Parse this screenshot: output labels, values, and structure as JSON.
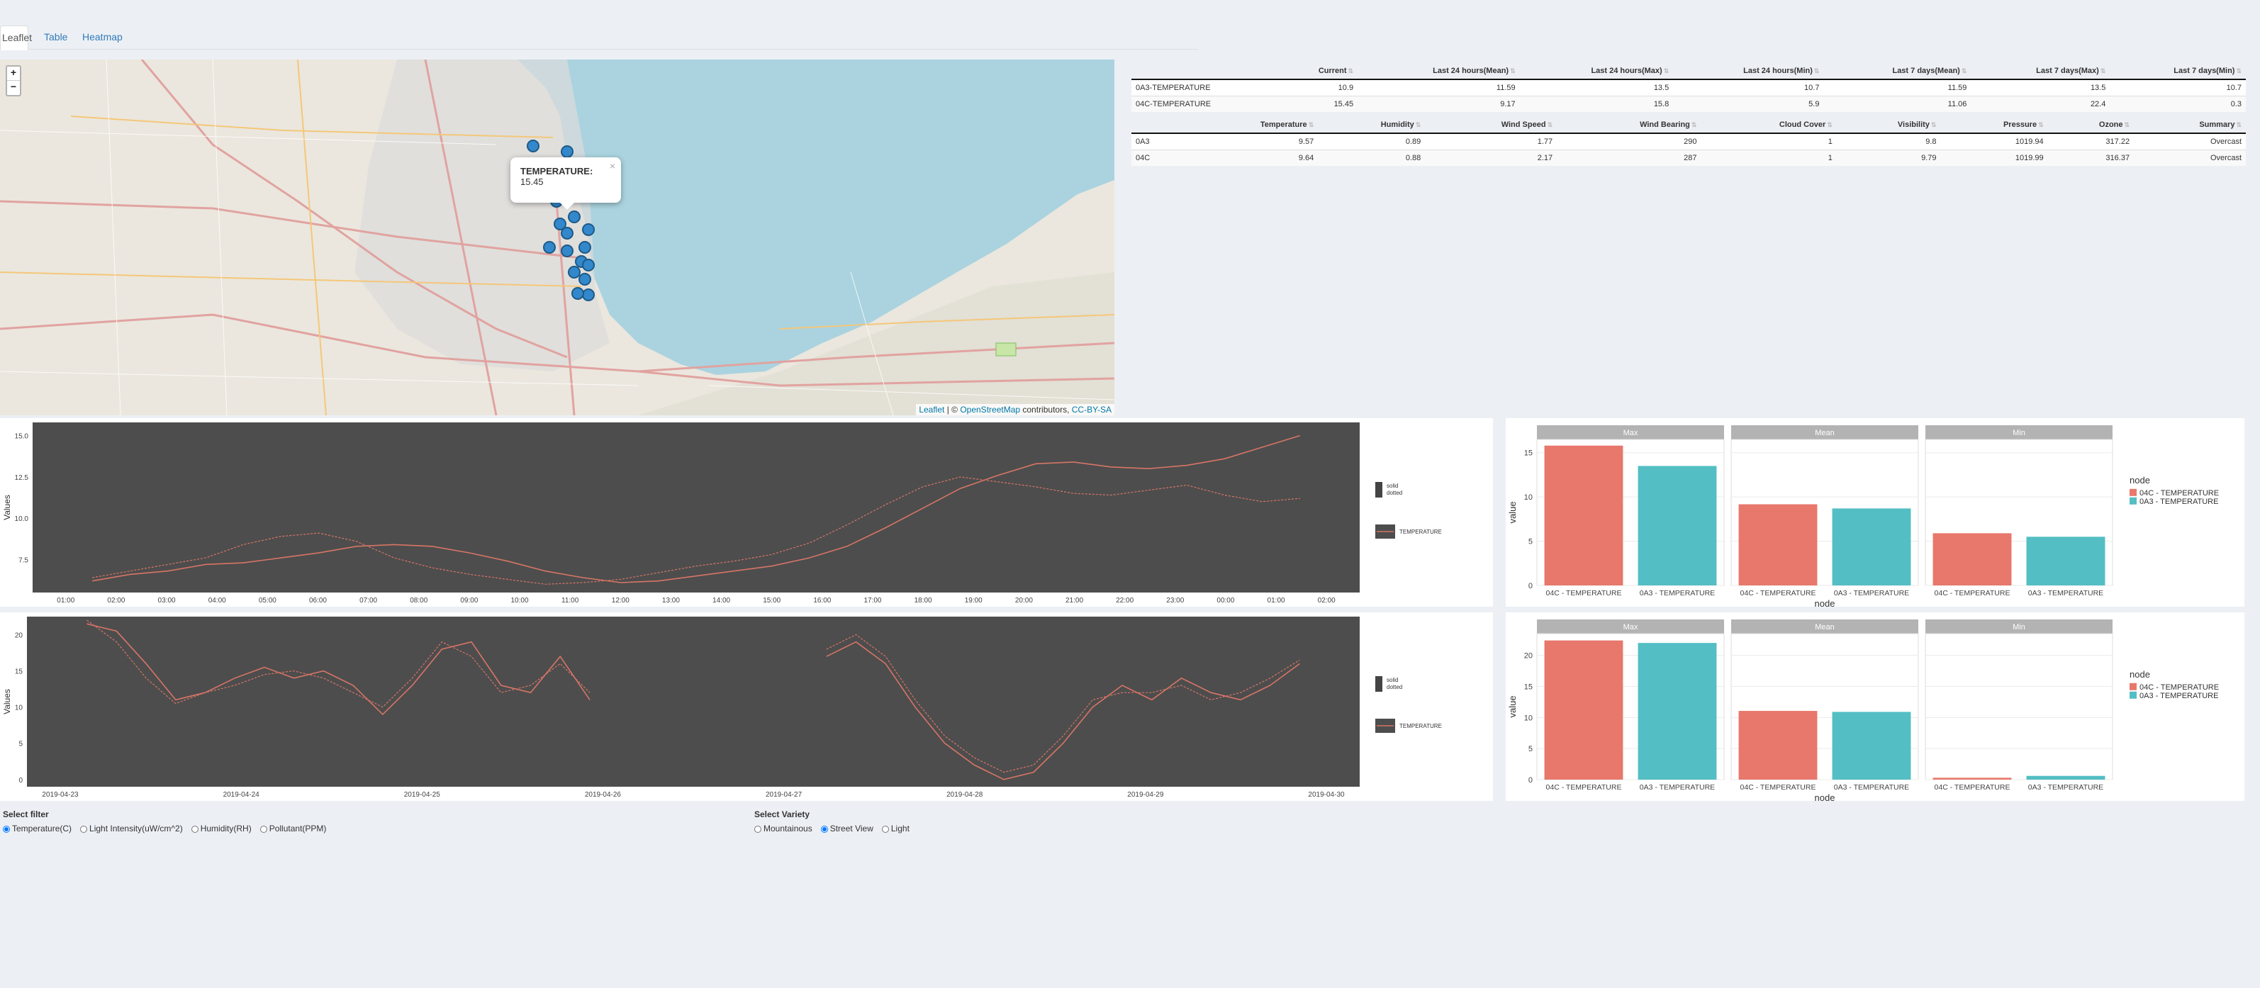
{
  "tabs": [
    {
      "label": "Leaflet"
    },
    {
      "label": "Table"
    },
    {
      "label": "Heatmap"
    }
  ],
  "map": {
    "zoom_in": "+",
    "zoom_out": "−",
    "popup": {
      "label": "TEMPERATURE:",
      "value": "15.45"
    },
    "attribution": {
      "leaflet": "Leaflet",
      "sep": " | © ",
      "osm": "OpenStreetMap",
      "contrib": " contributors, ",
      "license": "CC-BY-SA"
    }
  },
  "summary_table": {
    "headers": [
      "",
      "Current",
      "Last 24 hours(Mean)",
      "Last 24 hours(Max)",
      "Last 24 hours(Min)",
      "Last 7 days(Mean)",
      "Last 7 days(Max)",
      "Last 7 days(Min)"
    ],
    "rows": [
      [
        "0A3-TEMPERATURE",
        "10.9",
        "11.59",
        "13.5",
        "10.7",
        "11.59",
        "13.5",
        "10.7"
      ],
      [
        "04C-TEMPERATURE",
        "15.45",
        "9.17",
        "15.8",
        "5.9",
        "11.06",
        "22.4",
        "0.3"
      ]
    ]
  },
  "weather_table": {
    "headers": [
      "",
      "Temperature",
      "Humidity",
      "Wind Speed",
      "Wind Bearing",
      "Cloud Cover",
      "Visibility",
      "Pressure",
      "Ozone",
      "Summary"
    ],
    "rows": [
      [
        "0A3",
        "9.57",
        "0.89",
        "1.77",
        "290",
        "1",
        "9.8",
        "1019.94",
        "317.22",
        "Overcast"
      ],
      [
        "04C",
        "9.64",
        "0.88",
        "2.17",
        "287",
        "1",
        "9.79",
        "1019.99",
        "316.37",
        "Overcast"
      ]
    ]
  },
  "chart_data": [
    {
      "type": "line",
      "ylabel": "Values",
      "x_ticks": [
        "01:00",
        "02:00",
        "03:00",
        "04:00",
        "05:00",
        "06:00",
        "07:00",
        "08:00",
        "09:00",
        "10:00",
        "11:00",
        "12:00",
        "13:00",
        "14:00",
        "15:00",
        "16:00",
        "17:00",
        "18:00",
        "19:00",
        "20:00",
        "21:00",
        "22:00",
        "23:00",
        "00:00",
        "01:00",
        "02:00"
      ],
      "y_ticks": [
        "15.0",
        "12.5",
        "10.0",
        "7.5"
      ],
      "ylim": [
        5.5,
        15.8
      ],
      "legend": {
        "lt1": "solid",
        "lt2": "dotted",
        "series": "TEMPERATURE"
      },
      "series": [
        {
          "values": [
            6.2,
            6.6,
            6.8,
            7.2,
            7.3,
            7.6,
            7.9,
            8.3,
            8.4,
            8.3,
            7.9,
            7.4,
            6.8,
            6.4,
            6.1,
            6.2,
            6.5,
            6.8,
            7.1,
            7.6,
            8.3,
            9.4,
            10.6,
            11.8,
            12.6,
            13.3,
            13.4,
            13.1,
            13.0,
            13.2,
            13.6,
            14.3,
            15.0
          ]
        },
        {
          "values": [
            6.4,
            6.8,
            7.2,
            7.6,
            8.4,
            8.9,
            9.1,
            8.6,
            7.6,
            7.0,
            6.6,
            6.3,
            6.0,
            6.1,
            6.3,
            6.7,
            7.1,
            7.4,
            7.8,
            8.5,
            9.6,
            10.8,
            11.9,
            12.5,
            12.2,
            11.9,
            11.5,
            11.4,
            11.7,
            12.0,
            11.4,
            11.0,
            11.2
          ]
        }
      ]
    },
    {
      "type": "line",
      "ylabel": "Values",
      "x_ticks": [
        "2019-04-23",
        "2019-04-24",
        "2019-04-25",
        "2019-04-26",
        "2019-04-27",
        "2019-04-28",
        "2019-04-29",
        "2019-04-30"
      ],
      "y_ticks": [
        "20",
        "15",
        "10",
        "5",
        "0"
      ],
      "ylim": [
        -1,
        22.5
      ],
      "legend": {
        "lt1": "solid",
        "lt2": "dotted",
        "series": "TEMPERATURE"
      },
      "series": [
        {
          "values": [
            21.5,
            20.5,
            16,
            11,
            12,
            14,
            15.5,
            14,
            15,
            13,
            9,
            13,
            18,
            19,
            13,
            12,
            17,
            11,
            null,
            null,
            null,
            null,
            null,
            null,
            null,
            17,
            19,
            16,
            10,
            5,
            2,
            0,
            1,
            5,
            10,
            13,
            11,
            14,
            12,
            11,
            13,
            16
          ]
        },
        {
          "values": [
            22,
            19,
            14,
            10.5,
            12,
            13,
            14.5,
            15,
            14,
            12,
            10,
            14,
            19,
            17,
            12,
            13,
            16,
            12,
            null,
            null,
            null,
            null,
            null,
            null,
            null,
            18,
            20,
            17,
            11,
            6,
            3,
            1,
            2,
            6,
            11,
            12,
            12,
            13,
            11,
            12,
            14,
            16.5
          ]
        }
      ]
    },
    {
      "type": "bar",
      "facets": [
        "Max",
        "Mean",
        "Min"
      ],
      "categories": [
        "04C - TEMPERATURE",
        "0A3 - TEMPERATURE"
      ],
      "values": [
        [
          15.8,
          13.5
        ],
        [
          9.17,
          8.7
        ],
        [
          5.9,
          5.5
        ]
      ],
      "ylim": [
        0,
        16.5
      ],
      "y_ticks": [
        "15",
        "10",
        "5",
        "0"
      ],
      "xlabel": "node",
      "ylabel": "value",
      "legend_title": "node",
      "legend": [
        "04C - TEMPERATURE",
        "0A3 - TEMPERATURE"
      ],
      "colors": [
        "#e8776c",
        "#53bec4"
      ]
    },
    {
      "type": "bar",
      "facets": [
        "Max",
        "Mean",
        "Min"
      ],
      "categories": [
        "04C - TEMPERATURE",
        "0A3 - TEMPERATURE"
      ],
      "values": [
        [
          22.4,
          22.0
        ],
        [
          11.06,
          10.9
        ],
        [
          0.3,
          0.6
        ]
      ],
      "ylim": [
        0,
        23.5
      ],
      "y_ticks": [
        "20",
        "15",
        "10",
        "5",
        "0"
      ],
      "xlabel": "node",
      "ylabel": "value",
      "legend_title": "node",
      "legend": [
        "04C - TEMPERATURE",
        "0A3 - TEMPERATURE"
      ],
      "colors": [
        "#e8776c",
        "#53bec4"
      ]
    }
  ],
  "filters": {
    "left": {
      "title": "Select filter",
      "options": [
        "Temperature(C)",
        "Light Intensity(uW/cm^2)",
        "Humidity(RH)",
        "Pollutant(PPM)"
      ],
      "selected": 0
    },
    "right": {
      "title": "Select Variety",
      "options": [
        "Mountainous",
        "Street View",
        "Light"
      ],
      "selected": 1
    }
  },
  "colors": {
    "line": "#d77566",
    "plot_bg": "#4d4d4d",
    "lake": "#aad3df",
    "link": "#337ab7"
  }
}
